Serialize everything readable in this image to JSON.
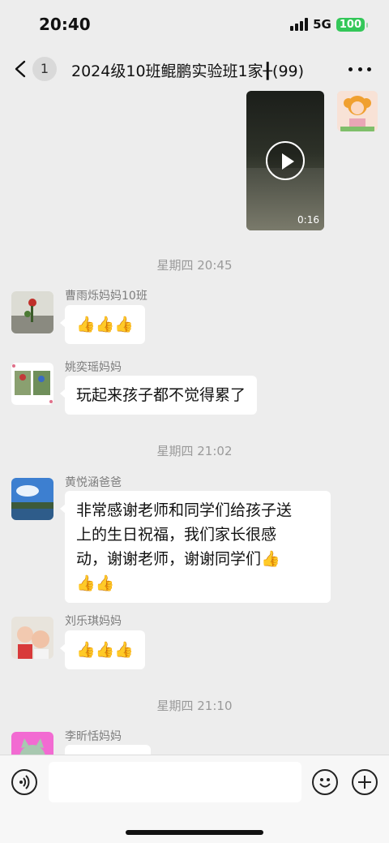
{
  "status_bar": {
    "time": "20:40",
    "network": "5G",
    "battery": "100"
  },
  "nav": {
    "back_badge": "1",
    "title": "2024级10班鲲鹏实验班1家╂(99)"
  },
  "video_message": {
    "duration": "0:16"
  },
  "messages": [
    {
      "type": "time",
      "text": "星期四 20:45"
    },
    {
      "type": "msg",
      "sender": "曹雨烁妈妈10班",
      "text": "👍👍👍"
    },
    {
      "type": "msg",
      "sender": "姚奕瑶妈妈",
      "text": "玩起来孩子都不觉得累了"
    },
    {
      "type": "time",
      "text": "星期四 21:02"
    },
    {
      "type": "msg",
      "sender": "黄悦涵爸爸",
      "lines": [
        "非常感谢老师和同学们给孩子送",
        "上的生日祝福，我们家长很感",
        "动，谢谢老师，谢谢同学们👍",
        "👍👍"
      ]
    },
    {
      "type": "msg",
      "sender": "刘乐琪妈妈",
      "text": "👍👍👍"
    },
    {
      "type": "time",
      "text": "星期四 21:10"
    },
    {
      "type": "msg",
      "sender": "李昕恬妈妈",
      "text": ""
    }
  ],
  "input": {
    "placeholder": ""
  },
  "colors": {
    "bubble": "#ffffff",
    "background": "#ededed",
    "battery": "#34c759"
  }
}
